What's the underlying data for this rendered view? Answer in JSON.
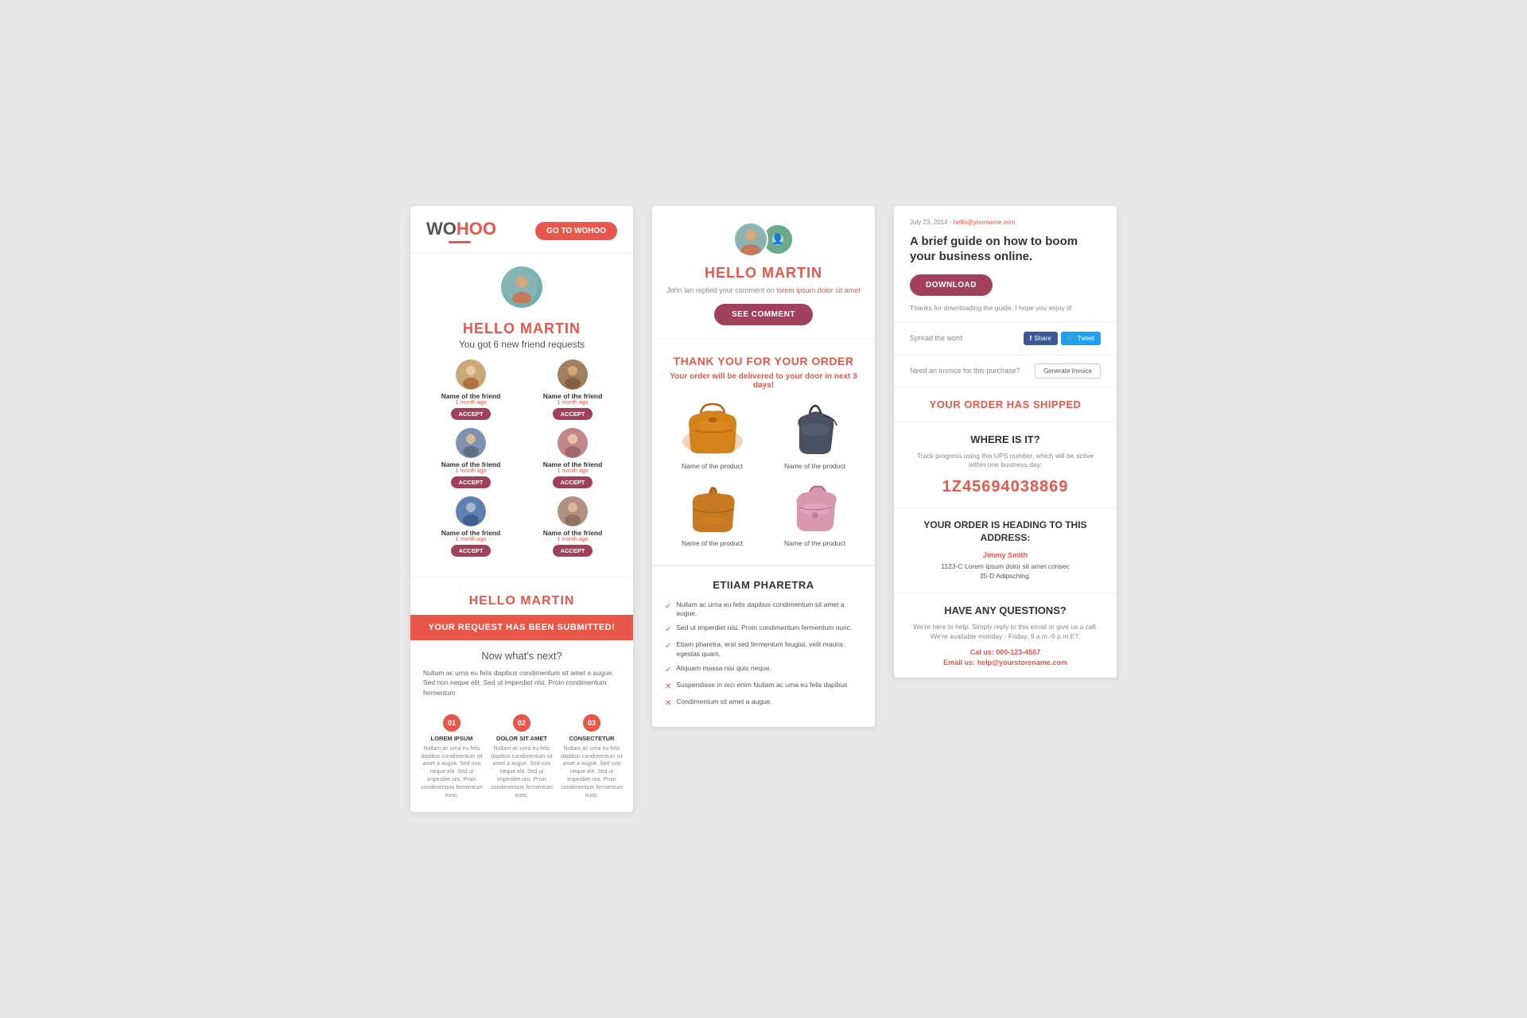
{
  "card1": {
    "logo_wo": "WO",
    "logo_hoo": "HOO",
    "go_btn": "GO TO WOHOO",
    "hello": "HELLO MARTIN",
    "subtitle": "You got 6 new friend requests",
    "friends": [
      {
        "name": "Name of the friend",
        "time": "1 month ago",
        "accept": "ACCEPT"
      },
      {
        "name": "Name of the friend",
        "time": "1 month ago",
        "accept": "ACCEPT"
      },
      {
        "name": "Name of the friend",
        "time": "1 month ago",
        "accept": "ACCEPT"
      },
      {
        "name": "Name of the friend",
        "time": "1 month ago",
        "accept": "ACCEPT"
      },
      {
        "name": "Name of the friend",
        "time": "1 month ago",
        "accept": "ACCEPT"
      },
      {
        "name": "Name of the friend",
        "time": "1 month ago",
        "accept": "ACCEPT"
      }
    ],
    "hello2": "HELLO MARTIN",
    "banner": "YOUR REQUEST HAS BEEN SUBMITTED!",
    "whats_next": "Now what's next?",
    "body_text": "Nullam ac urna eu felis dapibus condimentum sit amet a augue. Sed non neque elit. Sed ut imperdiet nisi. Proin condimentum fermentum",
    "steps": [
      {
        "num": "01",
        "title": "LOREM IPSUM",
        "text": "Nullam ac urna eu felis dapibus condimentum sit amet a augue. Sed non neque elit. Sed ut imperdiet nisi. Proin condimentum fermentum nunc."
      },
      {
        "num": "02",
        "title": "DOLOR SIT AMET",
        "text": "Nullam ac urna eu felis dapibus condimentum sit amet a augue. Sed non neque elit. Sed ut imperdiet nisi. Proin condimentum fermentum nunc."
      },
      {
        "num": "03",
        "title": "CONSECTETUR",
        "text": "Nullam ac urna eu felis dapibus condimentum sit amet a augue. Sed non neque elit. Sed ut imperdiet nisi. Proin condimentum fermentum nunc."
      }
    ]
  },
  "card2": {
    "hello": "HELLO MARTIN",
    "replied_prefix": "John lan replied your comment on",
    "replied_link": "lorem ipsum dolor sit amet",
    "see_comment_btn": "SEE COMMENT",
    "thank_title": "THANK YOU FOR YOUR ORDER",
    "thank_sub_prefix": "Your order will be delivered to your door in next",
    "thank_sub_highlight": "3 days!",
    "products": [
      {
        "name": "Name of the product"
      },
      {
        "name": "Name of the product"
      },
      {
        "name": "Name of the product"
      },
      {
        "name": "Name of the product"
      }
    ],
    "etiiam_title": "ETIIAM PHARETRA",
    "checklist": [
      {
        "text": "Nullam ac urna eu felis dapibus condimentum sit amet a augue.",
        "check": true
      },
      {
        "text": "Sed ut imperdiet nisi. Proin condimentum fermentum nunc.",
        "check": true
      },
      {
        "text": "Etiam pharetra, erat sed fermentum feugiat, velit mauris egestas quam,",
        "check": true
      },
      {
        "text": "Aliquam massa nisi quis neque.",
        "check": true
      },
      {
        "text": "Suspendisse in orci enim Nullam ac uma eu felis dapibus",
        "check": false
      },
      {
        "text": "Condimentum sit amet a augue.",
        "check": false
      }
    ]
  },
  "card3": {
    "date": "July 23, 2014 -",
    "email_link": "hello@yourname.com",
    "title": "A brief guide on how to boom your business online.",
    "download_btn": "DOWNLOAD",
    "thanks_text": "Thanks for downloading the guide. I hope you enjoy it!",
    "spread_label": "Spread the word",
    "share_btn": "Share",
    "tweet_btn": "Tweet",
    "invoice_label": "Need an invoice for this purchase?",
    "gen_invoice_btn": "Generate Invoice",
    "shipped_title": "YOUR ORDER HAS SHIPPED",
    "where_title": "WHERE IS IT?",
    "where_text": "Track progress using this UPS number, which will be active within one business day:",
    "tracking_num": "1Z45694038869",
    "address_title": "YOUR ORDER IS HEADING TO THIS ADDRESS:",
    "address_name": "Jimmy Smith",
    "address_line1": "1123-C Lorem ipsum dolor sit amet consec",
    "address_line2": "35-D Adipsching.",
    "questions_title": "HAVE ANY QUESTIONS?",
    "questions_text": "We're here to help. Simply reply to this email or give us a call. We're available monday - Friday, 9 a.m.-9 p.m ET.",
    "phone_label": "Cal us: 000-123-4567",
    "email_label": "Email us: help@yourstorename.com"
  }
}
